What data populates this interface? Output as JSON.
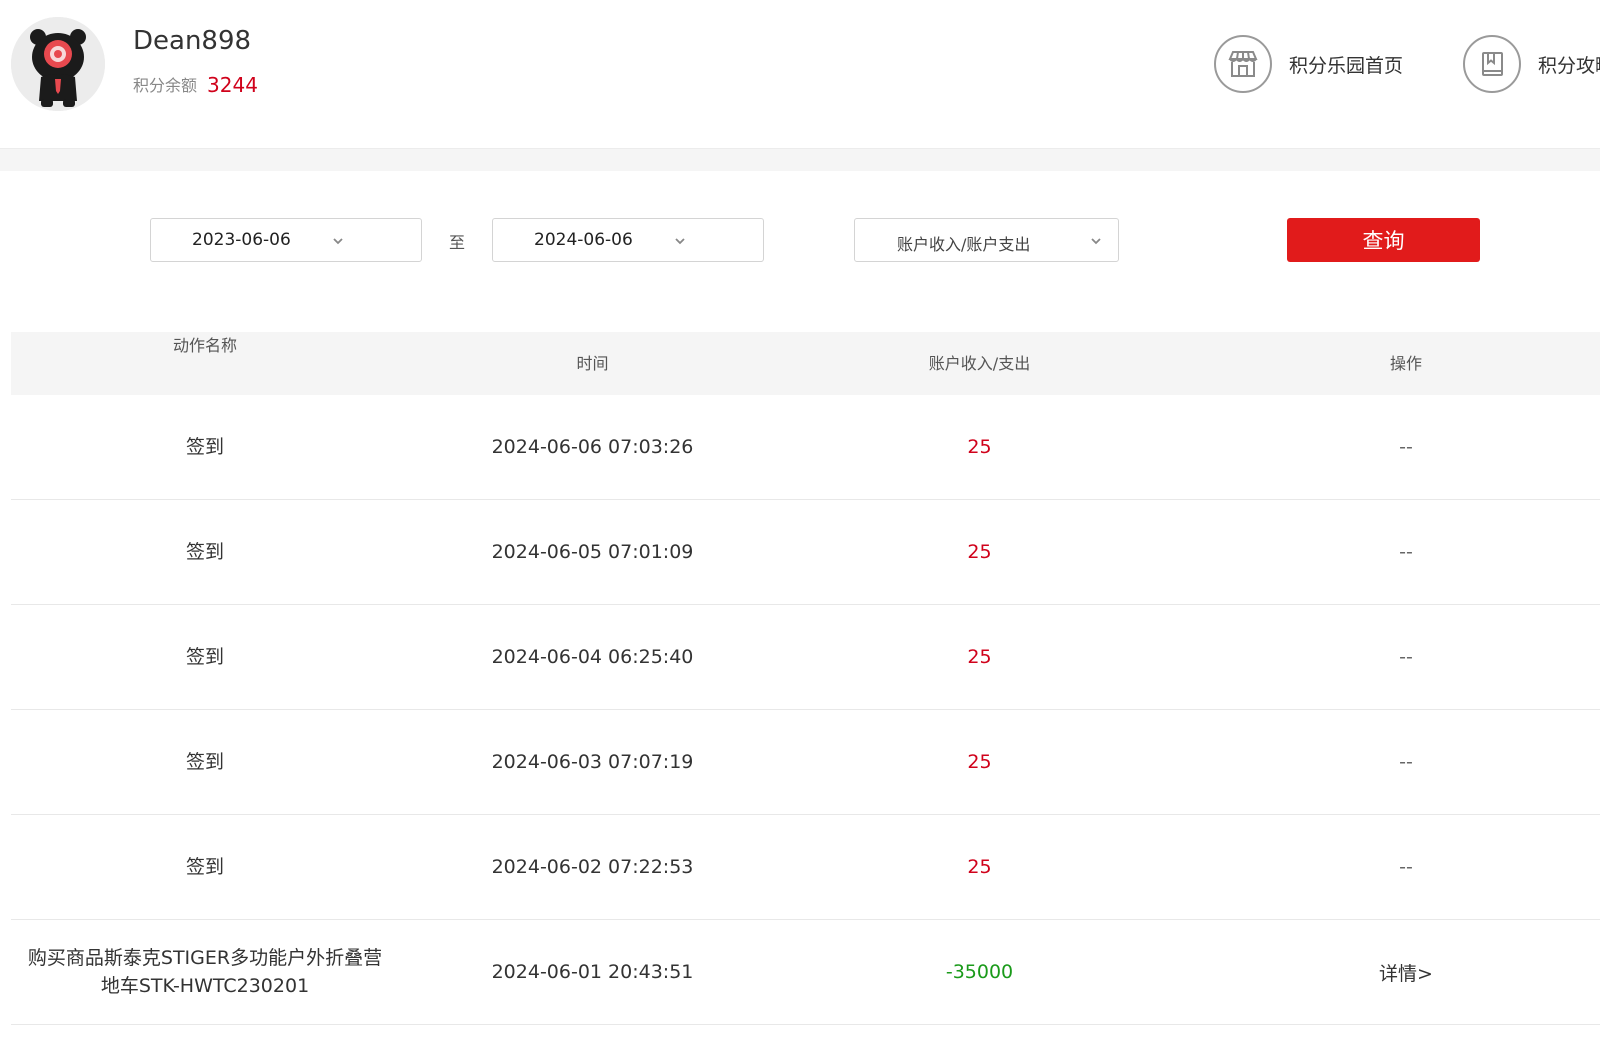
{
  "user": {
    "name": "Dean898",
    "balance_label": "积分余额",
    "balance_value": "3244"
  },
  "nav": [
    {
      "label": "积分乐园首页",
      "icon": "shop-icon"
    },
    {
      "label": "积分攻略",
      "icon": "book-icon"
    }
  ],
  "filter": {
    "date_from": "2023-06-06",
    "to_label": "至",
    "date_to": "2024-06-06",
    "type_value": "账户收入/账户支出",
    "query_label": "查询"
  },
  "table": {
    "headers": [
      "动作名称",
      "时间",
      "账户收入/支出",
      "操作"
    ],
    "rows": [
      {
        "action": "签到",
        "time": "2024-06-06 07:03:26",
        "amount": "25",
        "op": "--"
      },
      {
        "action": "签到",
        "time": "2024-06-05 07:01:09",
        "amount": "25",
        "op": "--"
      },
      {
        "action": "签到",
        "time": "2024-06-04 06:25:40",
        "amount": "25",
        "op": "--"
      },
      {
        "action": "签到",
        "time": "2024-06-03 07:07:19",
        "amount": "25",
        "op": "--"
      },
      {
        "action": "签到",
        "time": "2024-06-02 07:22:53",
        "amount": "25",
        "op": "--"
      },
      {
        "action": "购买商品斯泰克STIGER多功能户外折叠营地车STK-HWTC230201",
        "time": "2024-06-01 20:43:51",
        "amount": "-35000",
        "op": "详情>"
      }
    ]
  },
  "colors": {
    "accent_red": "#e11b1b",
    "income_red": "#d0021b",
    "expense_green": "#1a9a1a"
  }
}
